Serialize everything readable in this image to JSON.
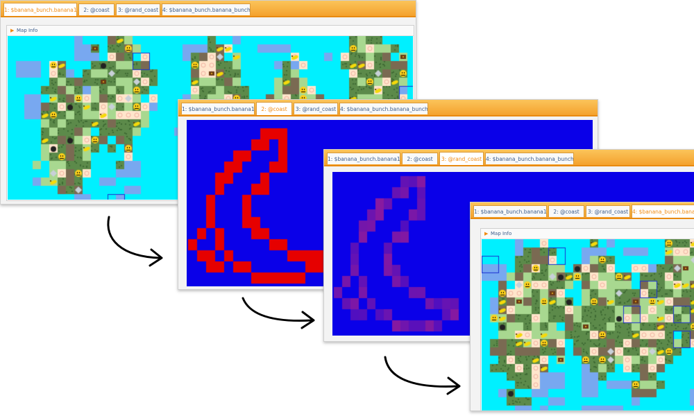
{
  "tabs": [
    {
      "label": "1: $banana_bunch.banana1"
    },
    {
      "label": "2: @coast"
    },
    {
      "label": "3: @rand_coast"
    },
    {
      "label": "4: $banana_bunch.banana_bunch"
    }
  ],
  "map_info_label": "Map Info",
  "panels": {
    "p1": {
      "active_tab": 0
    },
    "p2": {
      "active_tab": 1
    },
    "p3": {
      "active_tab": 2
    },
    "p4": {
      "active_tab": 3
    }
  },
  "colors": {
    "tab_accent": "#f08a10",
    "tab_text": "#3a5b8a",
    "terrain_water": "#00f0ff",
    "terrain_deep": "#78a8f0",
    "terrain_sand": "#ffe6cc",
    "terrain_grass": "#a8d890",
    "terrain_forest": "#5c8a4a",
    "coast_bg": "#0a00e8",
    "coast_mark": "#e60000",
    "rand_coast_mark": "#8a1a9e"
  },
  "icons": [
    "banana-icon",
    "smiley-icon",
    "monkey-icon",
    "treasure-chest-icon",
    "diamond-icon",
    "gold-bar-icon",
    "bomb-icon",
    "coconut-icon",
    "pen-icon",
    "grass-tile-icon",
    "sand-tile-icon",
    "forest-tile-icon"
  ]
}
